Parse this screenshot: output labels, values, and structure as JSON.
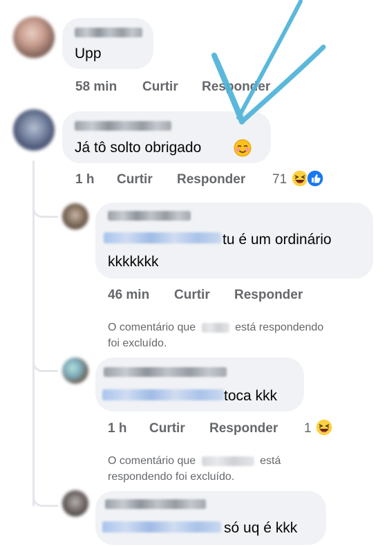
{
  "comments": [
    {
      "text": "Upp",
      "time": "58 min",
      "like_label": "Curtir",
      "reply_label": "Responder"
    },
    {
      "text": "Já tô solto obrigado",
      "emoji": "smiling-blush-emoji",
      "time": "1 h",
      "like_label": "Curtir",
      "reply_label": "Responder",
      "reaction_count": "71",
      "reactions": [
        "haha-reaction-icon",
        "like-reaction-icon"
      ]
    }
  ],
  "replies": [
    {
      "text_line1": "tu é um ordinário",
      "text_line2": "kkkkkkk",
      "time": "46 min",
      "like_label": "Curtir",
      "reply_label": "Responder"
    },
    {
      "deleted_part1": "O comentário que",
      "deleted_part2": "está respondendo",
      "deleted_line2": "foi excluído."
    },
    {
      "text": "toca kkk",
      "time": "1 h",
      "like_label": "Curtir",
      "reply_label": "Responder",
      "reaction_count": "1",
      "reactions": [
        "haha-reaction-icon"
      ]
    },
    {
      "deleted_part1": "O comentário que",
      "deleted_part2": "está",
      "deleted_line2": "respondendo foi excluído."
    },
    {
      "text": "só uq é kkk"
    }
  ],
  "colors": {
    "bubble": "#f0f2f5",
    "meta_text": "#65676b",
    "mention_blue": "#a9c4ec",
    "annotation_arrow": "#4fb3d9"
  }
}
